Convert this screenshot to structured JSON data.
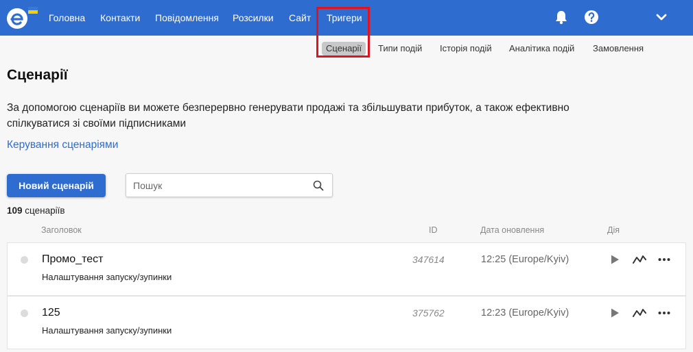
{
  "nav": {
    "items": [
      "Головна",
      "Контакти",
      "Повідомлення",
      "Розсилки",
      "Сайт",
      "Тригери"
    ]
  },
  "subnav": {
    "items": [
      "Сценарії",
      "Типи подій",
      "Історія подій",
      "Аналітика подій",
      "Замовлення"
    ],
    "active": "Сценарії"
  },
  "page": {
    "title": "Сценарії",
    "description": "За допомогою сценаріїв ви можете безперервно генерувати продажі та збільшувати прибуток, а також ефективно спілкуватися зі своїми підписниками",
    "manage_link": "Керування сценаріями"
  },
  "toolbar": {
    "new_button": "Новий сценарій",
    "search_placeholder": "Пошук"
  },
  "summary": {
    "count": "109",
    "count_label": "сценаріїв"
  },
  "table": {
    "columns": [
      "Заголовок",
      "ID",
      "Дата оновлення",
      "Дія"
    ],
    "rows": [
      {
        "name": "Промо_тест",
        "subtitle": "Налаштування запуску/зупинки",
        "id": "347614",
        "updated": "12:25 (Europe/Kyiv)"
      },
      {
        "name": "125",
        "subtitle": "Налаштування запуску/зупинки",
        "id": "375762",
        "updated": "12:23 (Europe/Kyiv)"
      }
    ]
  },
  "colors": {
    "brand": "#2e6ccf",
    "highlight": "#e0141e",
    "background": "#f7f7f7"
  },
  "icons": [
    "logo-icon",
    "bell-icon",
    "help-icon",
    "chevron-down-icon",
    "search-icon",
    "play-icon",
    "analytics-icon",
    "more-icon"
  ]
}
